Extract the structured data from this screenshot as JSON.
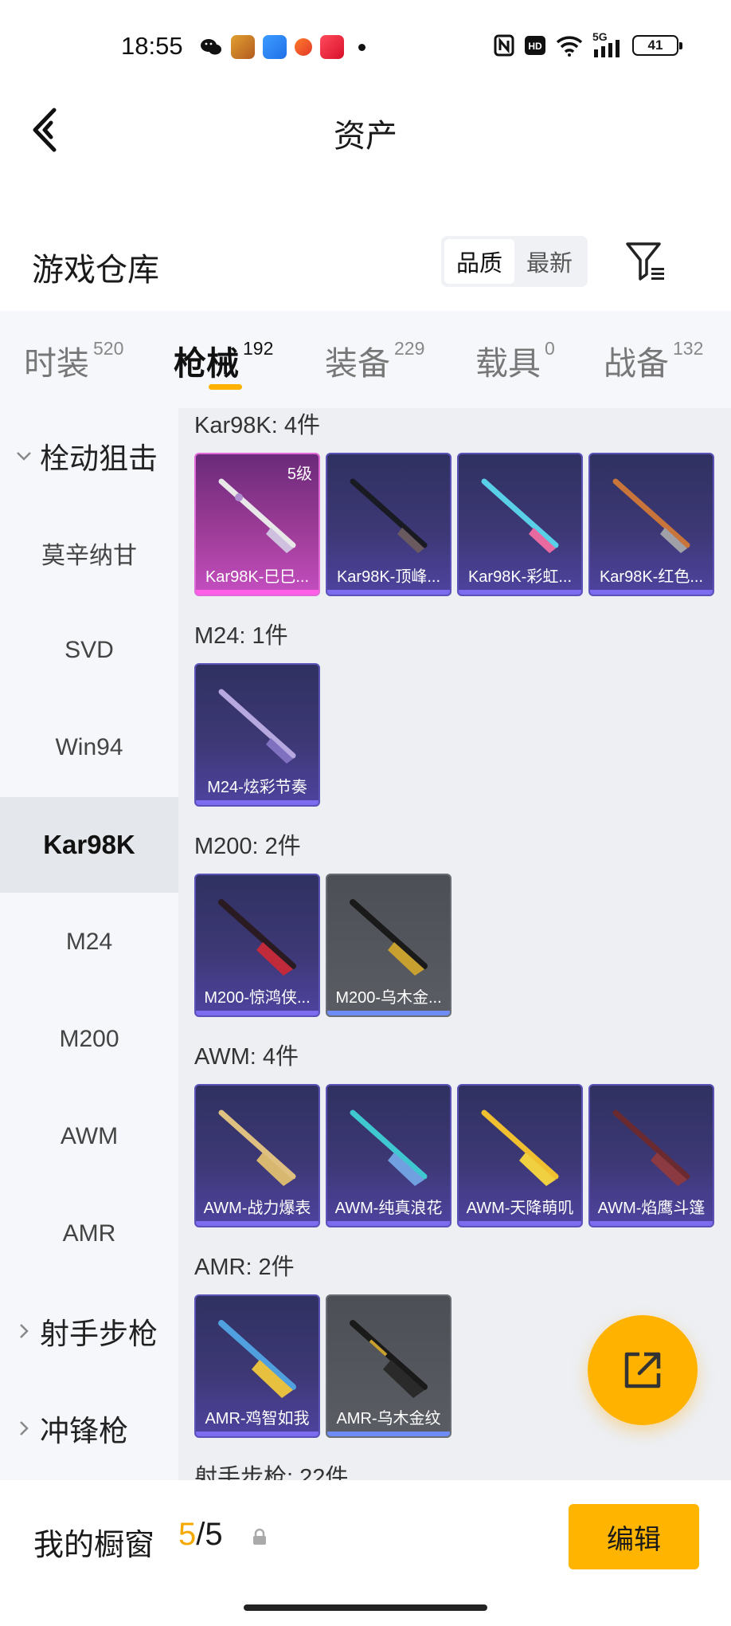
{
  "status_bar": {
    "time": "18:55",
    "network": "5G",
    "battery": "41"
  },
  "header": {
    "title": "资产"
  },
  "warehouse": {
    "title": "游戏仓库",
    "sort_options": [
      "品质",
      "最新"
    ]
  },
  "tabs": [
    {
      "label": "时装",
      "count": "520"
    },
    {
      "label": "枪械",
      "count": "192"
    },
    {
      "label": "装备",
      "count": "229"
    },
    {
      "label": "载具",
      "count": "0"
    },
    {
      "label": "战备",
      "count": "132"
    }
  ],
  "sidebar": {
    "items": [
      {
        "label": "栓动狙击",
        "type": "group",
        "expanded": true
      },
      {
        "label": "莫辛纳甘"
      },
      {
        "label": "SVD"
      },
      {
        "label": "Win94"
      },
      {
        "label": "Kar98K",
        "active": true
      },
      {
        "label": "M24"
      },
      {
        "label": "M200"
      },
      {
        "label": "AWM"
      },
      {
        "label": "AMR"
      },
      {
        "label": "射手步枪",
        "type": "group",
        "expanded": false
      },
      {
        "label": "冲锋枪",
        "type": "group",
        "expanded": false
      }
    ]
  },
  "sections": [
    {
      "title": "Kar98K: 4件",
      "items": [
        {
          "name": "Kar98K-巳巳...",
          "quality": "pink",
          "level": "5级"
        },
        {
          "name": "Kar98K-顶峰...",
          "quality": "purple"
        },
        {
          "name": "Kar98K-彩虹...",
          "quality": "purple"
        },
        {
          "name": "Kar98K-红色...",
          "quality": "purple"
        }
      ]
    },
    {
      "title": "M24: 1件",
      "items": [
        {
          "name": "M24-炫彩节奏",
          "quality": "purple"
        }
      ]
    },
    {
      "title": "M200: 2件",
      "items": [
        {
          "name": "M200-惊鸿侠...",
          "quality": "purple"
        },
        {
          "name": "M200-乌木金...",
          "quality": "gray"
        }
      ]
    },
    {
      "title": "AWM: 4件",
      "items": [
        {
          "name": "AWM-战力爆表",
          "quality": "purple"
        },
        {
          "name": "AWM-纯真浪花",
          "quality": "purple"
        },
        {
          "name": "AWM-天降萌叽",
          "quality": "purple"
        },
        {
          "name": "AWM-焰鹰斗篷",
          "quality": "purple"
        }
      ]
    },
    {
      "title": "AMR: 2件",
      "items": [
        {
          "name": "AMR-鸡智如我",
          "quality": "purple"
        },
        {
          "name": "AMR-乌木金纹",
          "quality": "gray"
        }
      ]
    },
    {
      "title": "射手步枪: 22件",
      "items": []
    }
  ],
  "showcase": {
    "label": "我的橱窗",
    "current": "5",
    "separator": "/",
    "total": "5"
  },
  "edit_button": {
    "label": "编辑"
  },
  "icons": {
    "back": "back-arrow-icon",
    "filter": "filter-icon",
    "share": "share-external-icon",
    "lock": "lock-icon"
  },
  "colors": {
    "accent": "#ffb400",
    "rare_pink": "#c44ec0",
    "epic_purple": "#4e43a0"
  }
}
